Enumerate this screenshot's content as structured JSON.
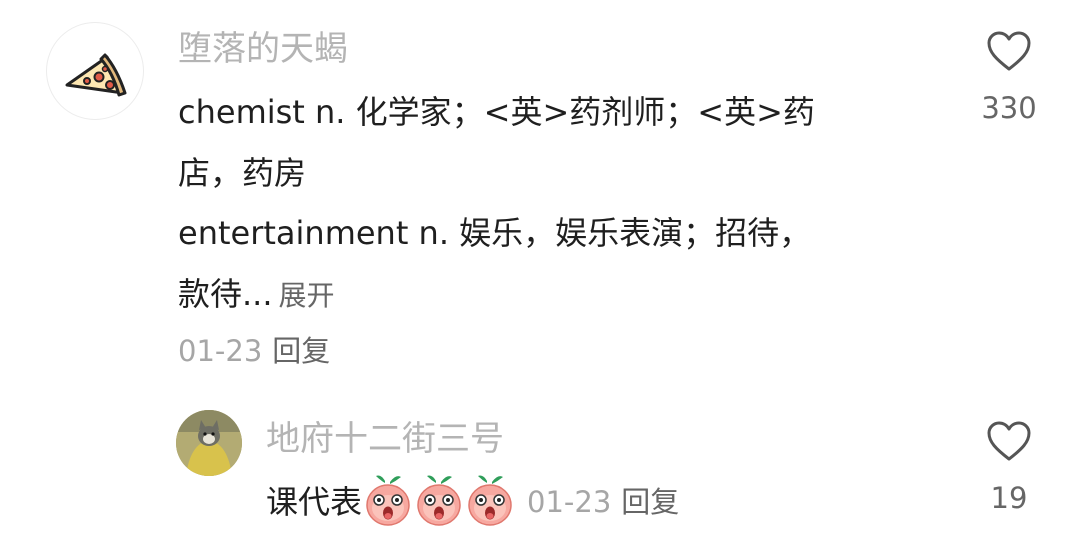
{
  "comment": {
    "author": "堕落的天蝎",
    "avatar_icon": "pizza-slice-icon",
    "lines": [
      "chemist n. 化学家；<英>药剂师；<英>药",
      "店，药房",
      "entertainment n. 娱乐，娱乐表演；招待，",
      "款待..."
    ],
    "expand_label": "展开",
    "date": "01-23",
    "reply_label": "回复",
    "like_icon": "heart-outline-icon",
    "like_count": "330"
  },
  "reply": {
    "author": "地府十二街三号",
    "avatar_icon": "cat-photo-avatar",
    "text": "课代表",
    "emojis": [
      "shocked-peach-emoji",
      "shocked-peach-emoji",
      "shocked-peach-emoji"
    ],
    "date": "01-23",
    "reply_label": "回复",
    "like_icon": "heart-outline-icon",
    "like_count": "19"
  },
  "colors": {
    "username": "#b4b4b4",
    "body_text": "#1f1f1f",
    "meta_text": "#a6a6a6",
    "secondary_text": "#666666",
    "pizza_crust": "#e2b87c",
    "pizza_pepperoni": "#e05a47"
  }
}
